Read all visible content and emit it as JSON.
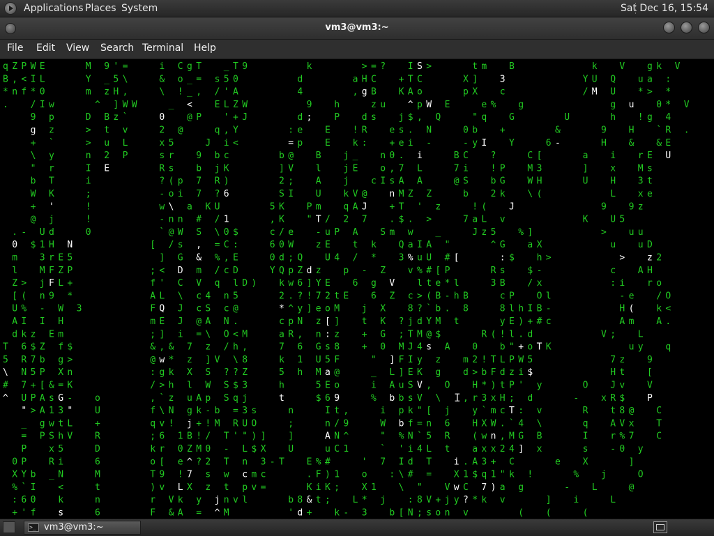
{
  "top_panel": {
    "menus": [
      "Applications",
      "Places",
      "System"
    ],
    "clock": "Sat Dec 16, 15:54"
  },
  "window": {
    "title": "vm3@vm3:~",
    "menus": [
      "File",
      "Edit",
      "View",
      "Search",
      "Terminal",
      "Help"
    ]
  },
  "terminal": {
    "foreground_color": "#22cc22",
    "highlight_color": "#ffffff",
    "background_color": "#000000",
    "rows": [
      "qZPWE    M 9'=   i CgT  _T9      k     >=?  IS>    tm  B        k  V  gk V",
      "B,<IL    Y _5\\   & o_= s50      d     aHC  +TC    X]  3        YU Q  ua :",
      "*nf*0    m zH,   \\ !_, /'A      4     ,gB  KAo    pX  c        /M U  *> *",
      ".  /Iw    ^ ]WW   _ <  ELZW      9  h   zu  ^pW E   e%  g         g u  0* V",
      "   9 p   D Bz`   0  @P  '+J     d;  P  ds  j$, Q   \"q  G     U    h  !g 4",
      "   g z   > t v   2 @   q,Y     :e  E  !R  es. N   0b  +     &    9  H  `R .",
      "   + `   > u L   x5   J i<     =p  E  k:  +ei -   -yI  Y   6-    H  &  &E",
      "   \\ y   n 2 P   sr  9 bc     b@  B  j_  n0. i   BC  ?   C[    a  i  rE U",
      "   \" r   I E     Rs  b jK     ]V  l  jE  o,7 L   7i  !P  M3    ]  x  Ms",
      "   b T   i       ?(p 7 R)     2;  A  j  cIsA A   @S  bG  WH    U  H  3t",
      "   W K   ;       -oi 7 ?6     SI  U  kV@  nMZ Z   b  2k  \\(       L  xe",
      "   + '   !       w\\ a KU     5K  Pm  qAJ  +T ' z   !(  J         9  9z",
      "   @ j   !       -nn # /1    ,K  \"T/ 2 7  .$. >   7aL v        K  U5",
      " .- Ud   0       `@W S \\0$   c/e  -uP A  Sm w  _   Jz5  %]       >  uu",
      " 0 $1H N        [ /s , =C:   60W  zE  t k  QaIA \"    ^G  aX       u  uD",
      " m  3rE5         ] G & %,E   0d;Q  U4 / *  3%uU #[    :$  h>       >  z2",
      " l  MFZP        ;< D m /cD   YQpZdz  p - Z  v%#[P    Rs  $-       c  AH",
      " Z> jFL+        f' C V q lD)  kw6]YE  6 g V  lte*l   3B  /x       :i  ro",
      " [( n9 *        AL \\ c4 n5    2.?!72tE  6 Z c>(B-hB   cP  Ol       -e  /O",
      " U% - W 3       FQ J cS c@    *^y]eoM  j X  8?`b. 8   8lhIB-       H(  k<",
      " AI I H         mE J @A N.    cpN z[]  t K ?jdYM t    yE)+#c       Am  A.",
      " dkz Em         ;] i =\\ O<M   aR, n:z  + G ;TM@$    R(!l.d       V;  L",
      "T 6$Z f$        &,& 7 z /h,   7 6 Gs8  + 0 MJ4s A  0  b\"+oTK        uy  q",
      "5 R7b g>        @w* z ]V \\8   k 1 U5F   \" ]FIy z  m2!TLPW5        7z  9",
      "\\ N5P Xn        :gk X S ??Z   5 h Ma@   _ L]EK g  d>bFdzi$        Ht  [",
      "# 7+[&=K        />h l W S$3   h   5Eo   i AuSV, O  H*)tP' y    O  Jv  V",
      "^ UPAsG-  o     ,`z uAp Sqj   t   $69   % bbsV \\  ,r3xH; d    -  xR$  P",
      "  \">A13\"  U     f\\N gk-b =3s   n   It,   i pk\"[ j  y`mcT: v    R  t8@  C",
      "  _ gwtL  +     qv! j+!M RUO   ;   n/9   W bf=n 6  HXW.`4 \\    q  AVx  T",
      "  = PShV  R     ;6 1B!/ T'\")]  ]   AN^   \" %N`5 R  (wn,MG B    I  r%7  C",
      "  P  x5   D     kr 0ZM0 - L$X  U   uC1   ` 'i4L t  axx24] x    s  -0 y",
      " 0P  Ri   6     o[ e^?2 T n 3-T  E%#   ' 7 Id T  i.A3+ C    e  X    ]",
      " XYb _N   M     T9 !7 s w cmc    .F)1  o  :\\# =  X1$q1\"k !    %  j   O",
      " %`I  <   t     )v LX z t pv=    KiK;  X1  \\ \"  VwC 7)a g    -  L   @",
      " :60  k   n     r Vk y jnvl    b8&t;  L* j  :8V+jy?*k v    ]  i   L",
      " +'f  s   6     F &A = ^M      'd+  k- 3  b[N;son v     (  (   ("
    ]
  }
}
